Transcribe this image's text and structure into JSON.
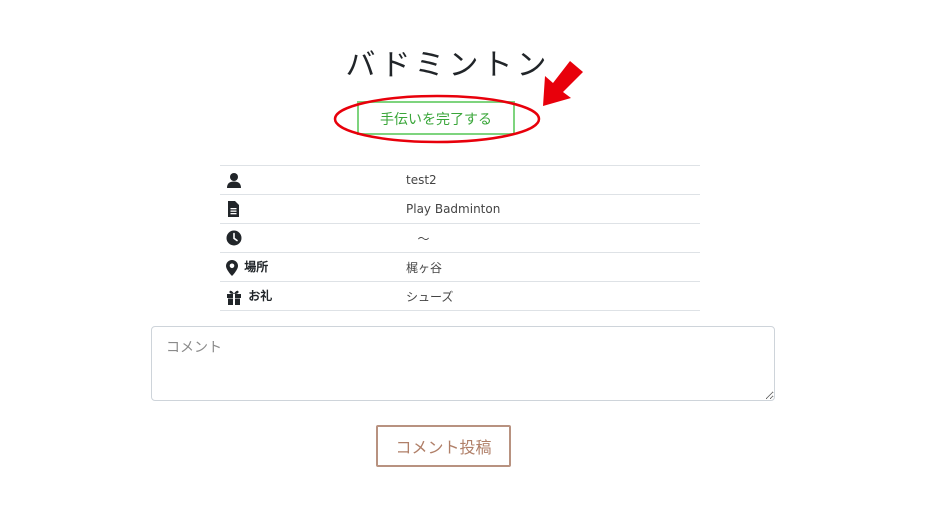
{
  "page_title": "バドミントン",
  "complete_button": "手伝いを完了する",
  "details": {
    "user": "test2",
    "description": "Play Badminton",
    "time": "〜",
    "place_label": "場所",
    "place": "梶ヶ谷",
    "reward_label": "お礼",
    "reward": "シューズ"
  },
  "comment": {
    "placeholder": "コメント",
    "value": ""
  },
  "post_button": "コメント投稿",
  "colors": {
    "complete_border": "#7ed47e",
    "complete_text": "#3aa63a",
    "annotation_red": "#e8000b",
    "post_border": "#b89280",
    "post_text": "#b07f68"
  },
  "icons": [
    "user-icon",
    "file-icon",
    "clock-icon",
    "map-marker-icon",
    "gift-icon",
    "arrow-icon"
  ]
}
